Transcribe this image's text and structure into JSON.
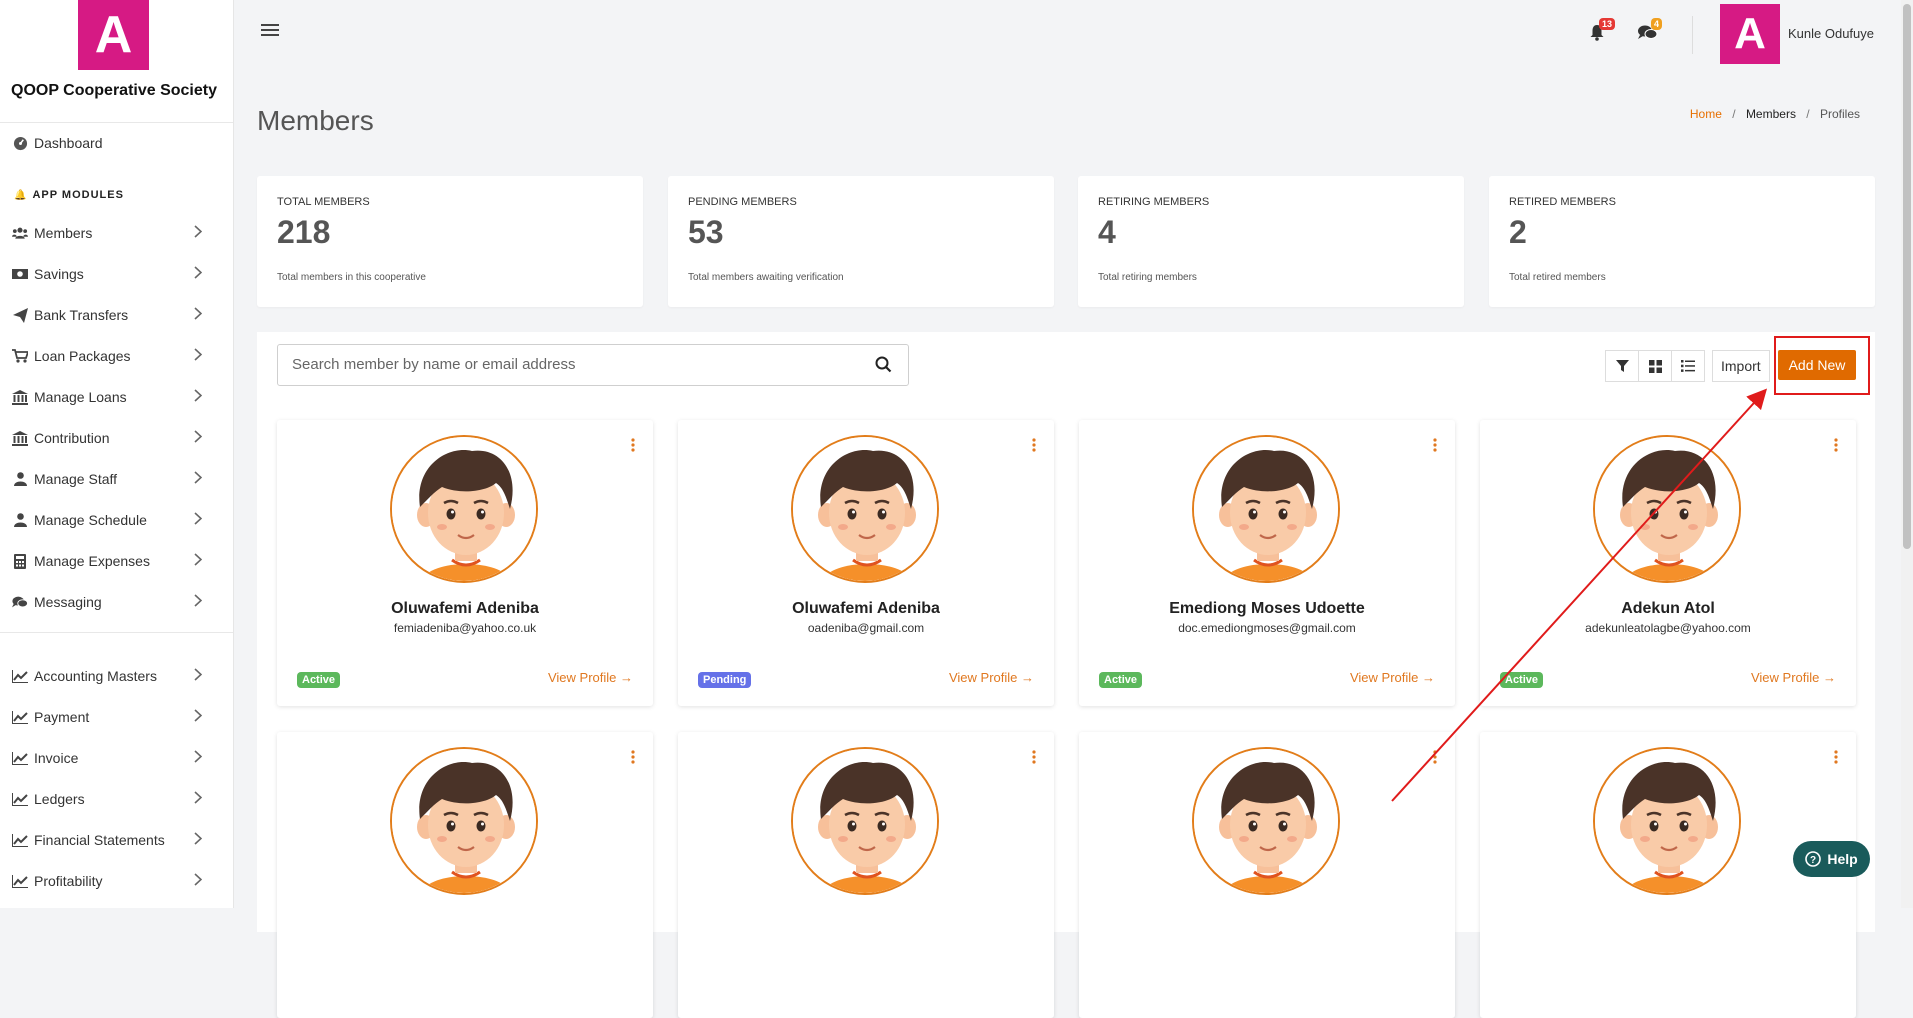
{
  "app": {
    "logo_letter": "A",
    "name": "QOOP Cooperative Society",
    "brand_color": "#d61a84",
    "accent_color": "#e06a00"
  },
  "sidebar": {
    "dashboard": {
      "label": "Dashboard",
      "icon": "dashboard-icon"
    },
    "section_label": "APP MODULES",
    "modules": [
      {
        "label": "Members",
        "icon": "users-icon"
      },
      {
        "label": "Savings",
        "icon": "money-icon"
      },
      {
        "label": "Bank Transfers",
        "icon": "paper-plane-icon"
      },
      {
        "label": "Loan Packages",
        "icon": "cart-icon"
      },
      {
        "label": "Manage Loans",
        "icon": "bank-icon"
      },
      {
        "label": "Contribution",
        "icon": "bank-icon"
      },
      {
        "label": "Manage Staff",
        "icon": "user-icon"
      },
      {
        "label": "Manage Schedule",
        "icon": "user-icon"
      },
      {
        "label": "Manage Expenses",
        "icon": "calculator-icon"
      },
      {
        "label": "Messaging",
        "icon": "comments-icon"
      }
    ],
    "finance": [
      {
        "label": "Accounting Masters",
        "icon": "chart-icon"
      },
      {
        "label": "Payment",
        "icon": "chart-icon"
      },
      {
        "label": "Invoice",
        "icon": "chart-icon"
      },
      {
        "label": "Ledgers",
        "icon": "chart-icon"
      },
      {
        "label": "Financial Statements",
        "icon": "chart-icon"
      },
      {
        "label": "Profitability",
        "icon": "chart-icon"
      }
    ]
  },
  "topbar": {
    "notifications_count": "13",
    "messages_count": "4",
    "user_initial": "A",
    "user_name": "Kunle Odufuye"
  },
  "page": {
    "title": "Members",
    "breadcrumb": {
      "home": "Home",
      "section": "Members",
      "current": "Profiles"
    }
  },
  "stats": [
    {
      "label": "TOTAL MEMBERS",
      "value": "218",
      "desc": "Total members in this cooperative"
    },
    {
      "label": "PENDING MEMBERS",
      "value": "53",
      "desc": "Total members awaiting verification"
    },
    {
      "label": "RETIRING MEMBERS",
      "value": "4",
      "desc": "Total retiring members"
    },
    {
      "label": "RETIRED MEMBERS",
      "value": "2",
      "desc": "Total retired members"
    }
  ],
  "toolbar": {
    "search_placeholder": "Search member by name or email address",
    "import_label": "Import",
    "add_label": "Add New"
  },
  "members": [
    {
      "name": "Oluwafemi Adeniba",
      "email": "femiadeniba@yahoo.co.uk",
      "status": "Active",
      "link": "View Profile"
    },
    {
      "name": "Oluwafemi Adeniba",
      "email": "oadeniba@gmail.com",
      "status": "Pending",
      "link": "View Profile"
    },
    {
      "name": "Emediong Moses Udoette",
      "email": "doc.emediongmoses@gmail.com",
      "status": "Active",
      "link": "View Profile"
    },
    {
      "name": "Adekun Atol",
      "email": "adekunleatolagbe@yahoo.com",
      "status": "Active",
      "link": "View Profile"
    },
    {
      "name": "",
      "email": "",
      "status": "",
      "link": ""
    },
    {
      "name": "",
      "email": "",
      "status": "",
      "link": ""
    },
    {
      "name": "",
      "email": "",
      "status": "",
      "link": ""
    },
    {
      "name": "",
      "email": "",
      "status": "",
      "link": ""
    }
  ],
  "status_colors": {
    "Active": "#5cb85c",
    "Pending": "#6571e8"
  },
  "help": {
    "label": "Help"
  }
}
